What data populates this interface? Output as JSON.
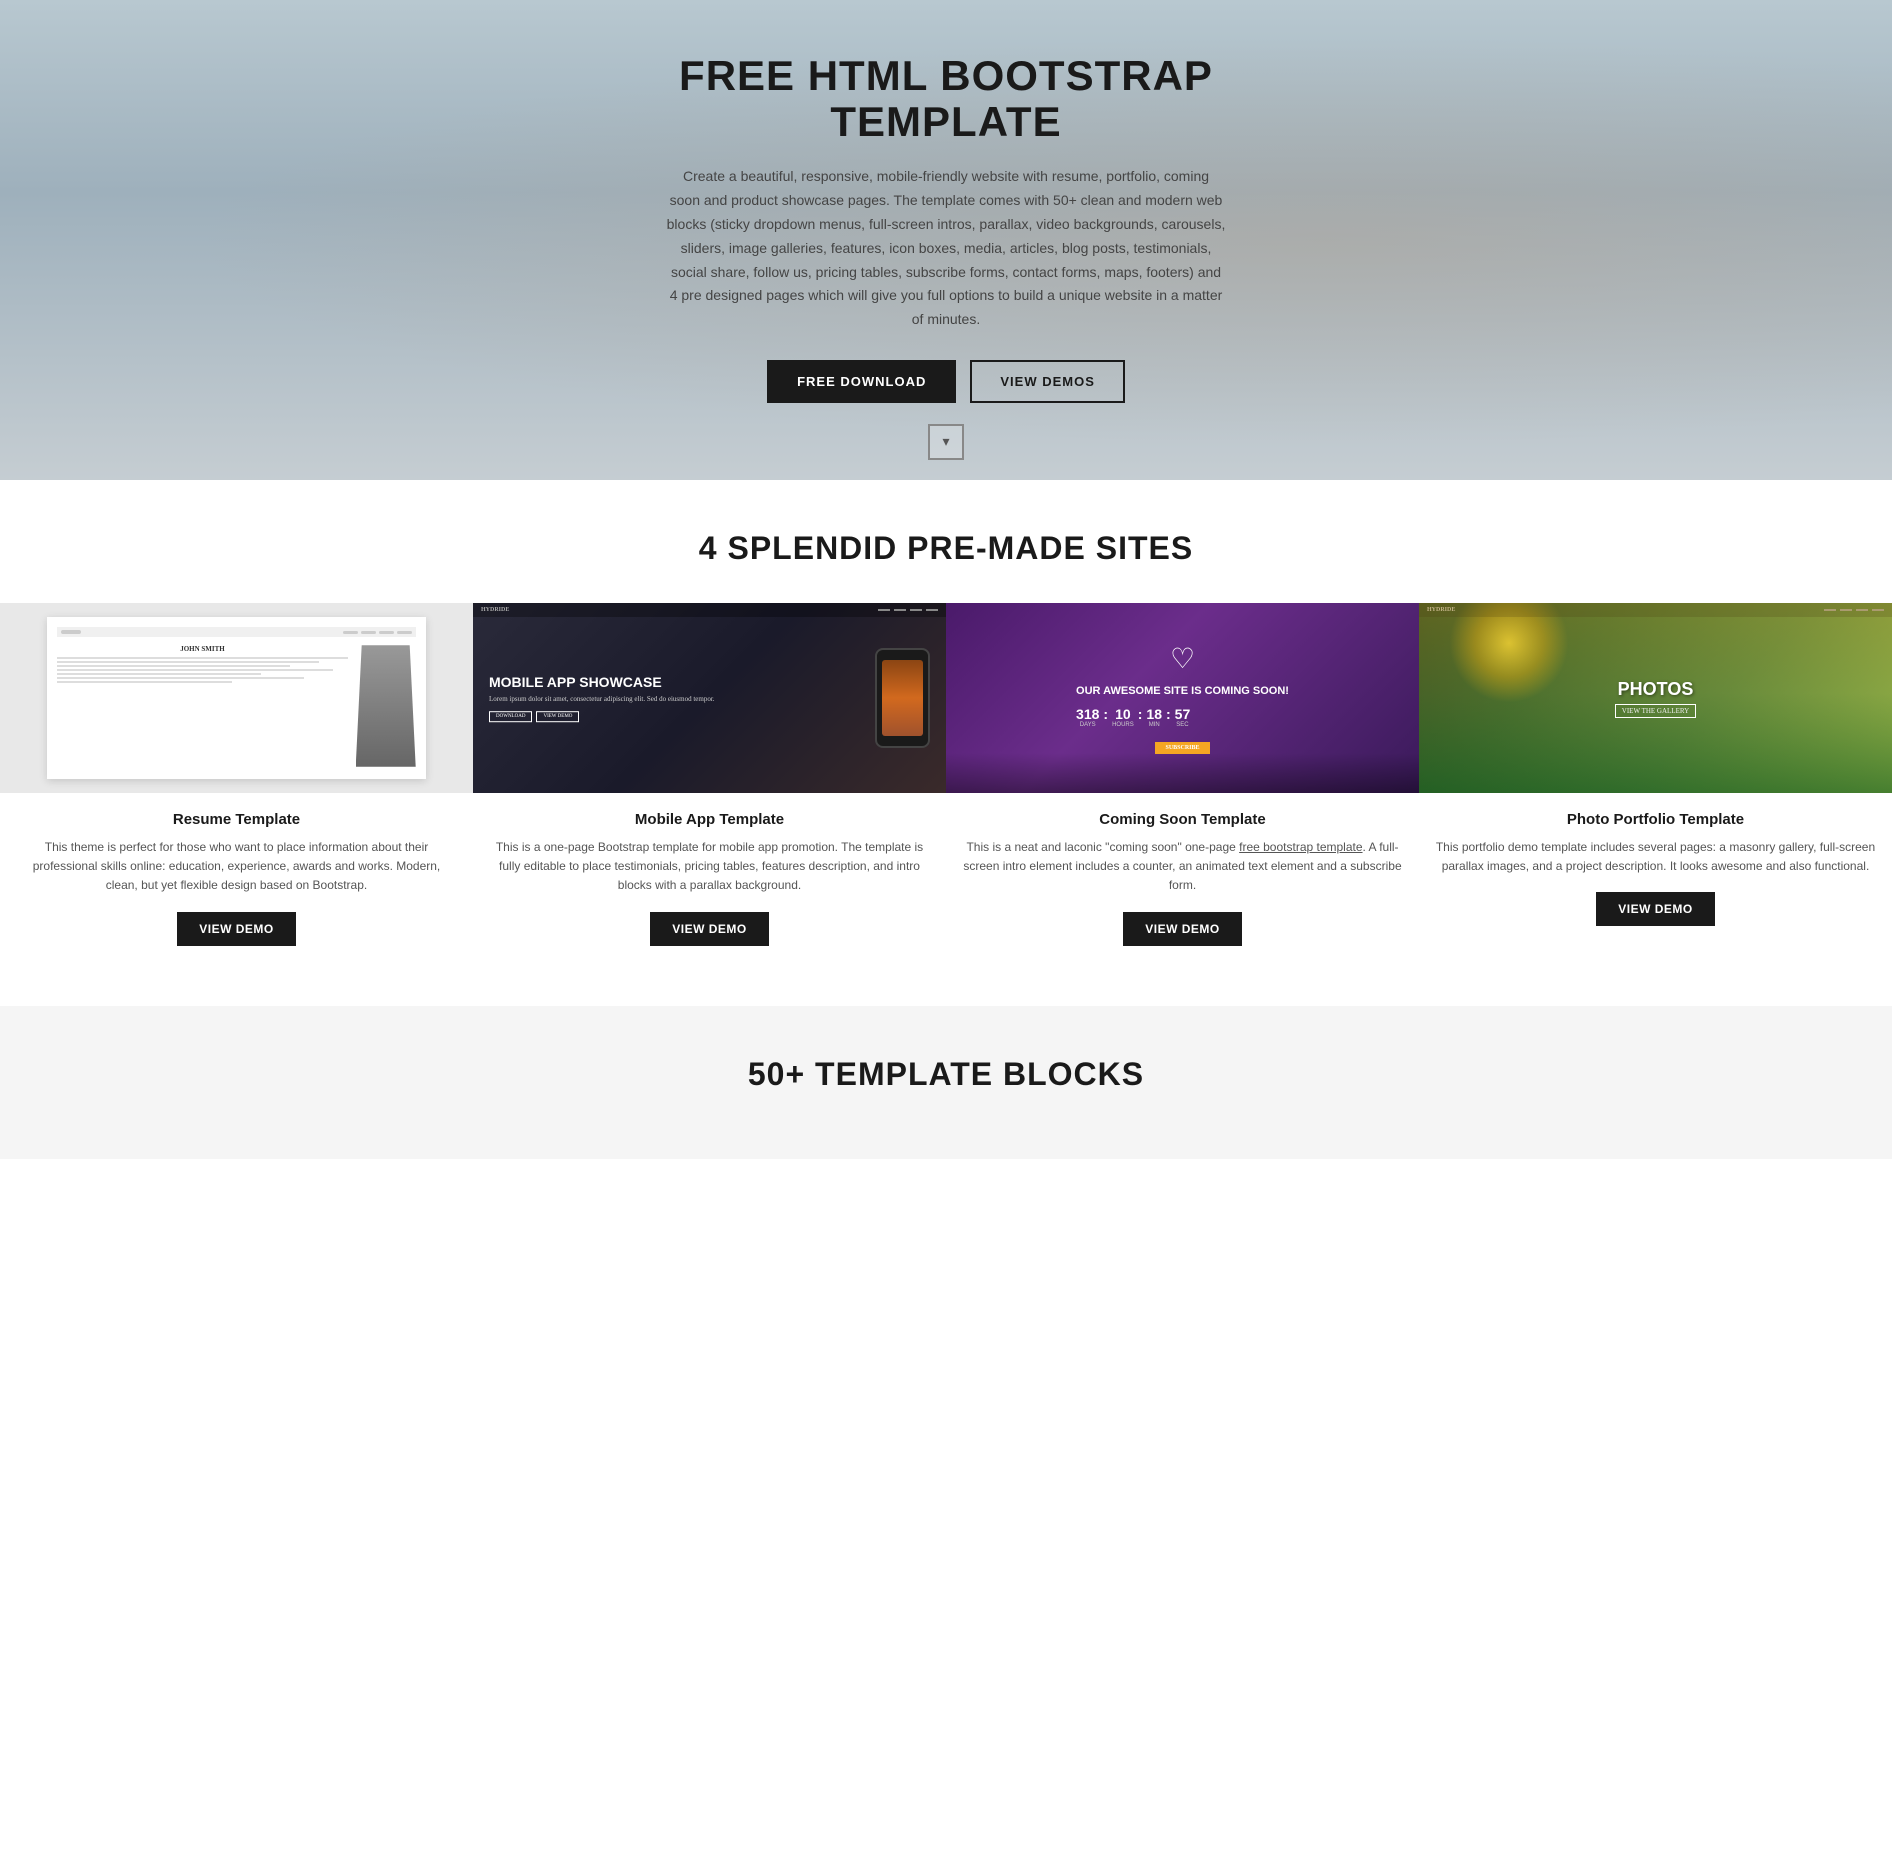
{
  "hero": {
    "title": "FREE HTML BOOTSTRAP TEMPLATE",
    "description": "Create a beautiful, responsive, mobile-friendly website with resume, portfolio, coming soon and product showcase pages. The template comes with 50+ clean and modern web blocks (sticky dropdown menus, full-screen intros, parallax, video backgrounds, carousels, sliders, image galleries, features, icon boxes, media, articles, blog posts, testimonials, social share, follow us, pricing tables, subscribe forms, contact forms, maps, footers) and 4 pre designed pages which will give you full options to build a unique website in a matter of minutes.",
    "buttons": {
      "primary": "FREE DOWNLOAD",
      "secondary": "VIEW DEMOS"
    },
    "scroll_arrow": "▾"
  },
  "premade": {
    "section_title": "4 SPLENDID PRE-MADE SITES",
    "cards": [
      {
        "id": "resume",
        "title": "Resume Template",
        "description": "This theme is perfect for those who want to place information about their professional skills online: education, experience, awards and works. Modern, clean, but yet flexible design based on Bootstrap.",
        "button_label": "VIEW DEMO",
        "name_label": "JOHN SMITH"
      },
      {
        "id": "mobile-app",
        "title": "Mobile App Template",
        "description": "This is a one-page Bootstrap template for mobile app promotion. The template is fully editable to place testimonials, pricing tables, features description, and intro blocks with a parallax background.",
        "button_label": "VIEW DEMO",
        "heading": "MOBILE APP SHOWCASE",
        "subtext": "Lorem ipsum dolor sit amet, consectetur adipiscing elit. Sed do eiusmod tempor.",
        "btn1": "DOWNLOAD",
        "btn2": "VIEW DEMO"
      },
      {
        "id": "coming-soon",
        "title": "Coming Soon Template",
        "description": "This is a neat and laconic \"coming soon\" one-page free bootstrap template. A full-screen intro element includes a counter, an animated text element and a subscribe form.",
        "button_label": "VIEW DEMO",
        "overlay_title": "OUR AWESOME SITE IS COMING SOON!",
        "countdown": [
          "318",
          "10",
          "18",
          "57"
        ],
        "countdown_labels": [
          "DAYS",
          "HOURS",
          "MIN",
          "SEC"
        ]
      },
      {
        "id": "photo-portfolio",
        "title": "Photo Portfolio Template",
        "description": "This portfolio demo template includes several pages: a masonry gallery, full-screen parallax images, and a project description. It looks awesome and also functional.",
        "button_label": "VIEW DEMO",
        "heading": "PHOTOS",
        "subtext": "VIEW THE GALLERY"
      }
    ]
  },
  "blocks": {
    "section_title": "50+ TEMPLATE BLOCKS"
  }
}
